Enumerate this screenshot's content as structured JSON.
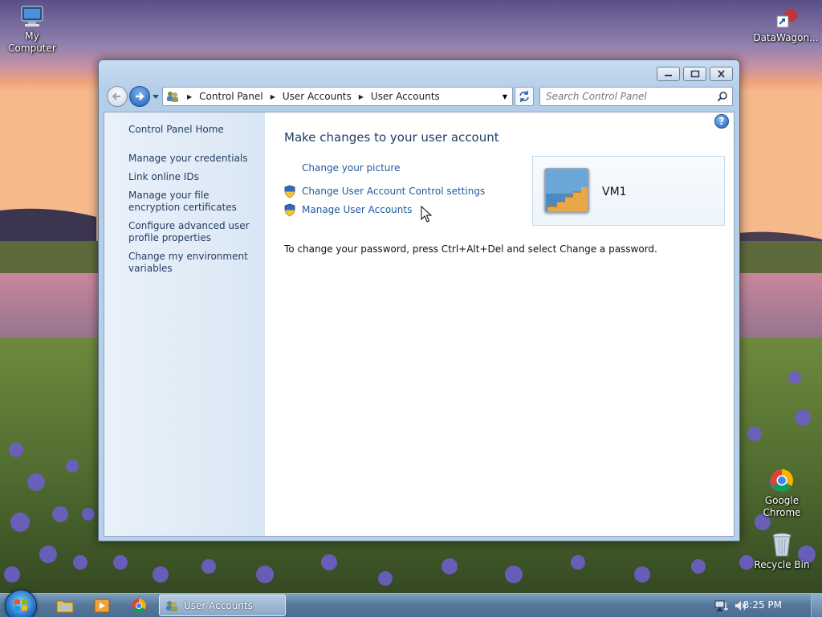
{
  "desktop": {
    "icons": [
      {
        "label": "My Computer"
      },
      {
        "label": "DataWagon..."
      },
      {
        "label": "Google Chrome"
      },
      {
        "label": "Recycle Bin"
      }
    ]
  },
  "window": {
    "breadcrumb": [
      "Control Panel",
      "User Accounts",
      "User Accounts"
    ],
    "search_placeholder": "Search Control Panel",
    "help_label": "?"
  },
  "sidebar": {
    "items": [
      {
        "label": "Control Panel Home"
      },
      {
        "label": "Manage your credentials"
      },
      {
        "label": "Link online IDs"
      },
      {
        "label": "Manage your file encryption certificates"
      },
      {
        "label": "Configure advanced user profile properties"
      },
      {
        "label": "Change my environment variables"
      }
    ]
  },
  "main": {
    "title": "Make changes to your user account",
    "tasks": [
      {
        "label": "Change your picture",
        "shield": false
      },
      {
        "label": "Change User Account Control settings",
        "shield": true
      },
      {
        "label": "Manage User Accounts",
        "shield": true
      }
    ],
    "account_name": "VM1",
    "password_note": "To change your password, press Ctrl+Alt+Del and select Change a password."
  },
  "taskbar": {
    "active_window": "User Accounts",
    "clock": "8:25 PM"
  }
}
